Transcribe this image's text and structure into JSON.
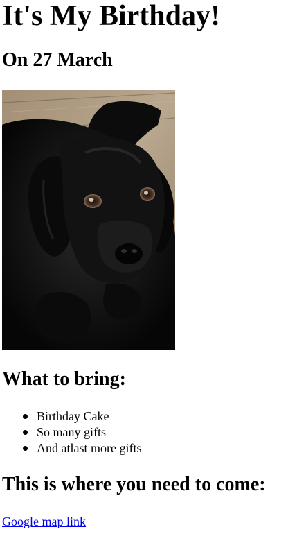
{
  "header": {
    "title": "It's My Birthday!",
    "date": "On 27 March"
  },
  "photo": {
    "subject": "black-puppy-photo"
  },
  "bring": {
    "heading": "What to bring:",
    "items": [
      "Birthday Cake",
      "So many gifts",
      "And atlast more gifts"
    ]
  },
  "location": {
    "heading": "This is where you need to come:",
    "link_label": "Google map link",
    "link_color": "#0000ee"
  }
}
